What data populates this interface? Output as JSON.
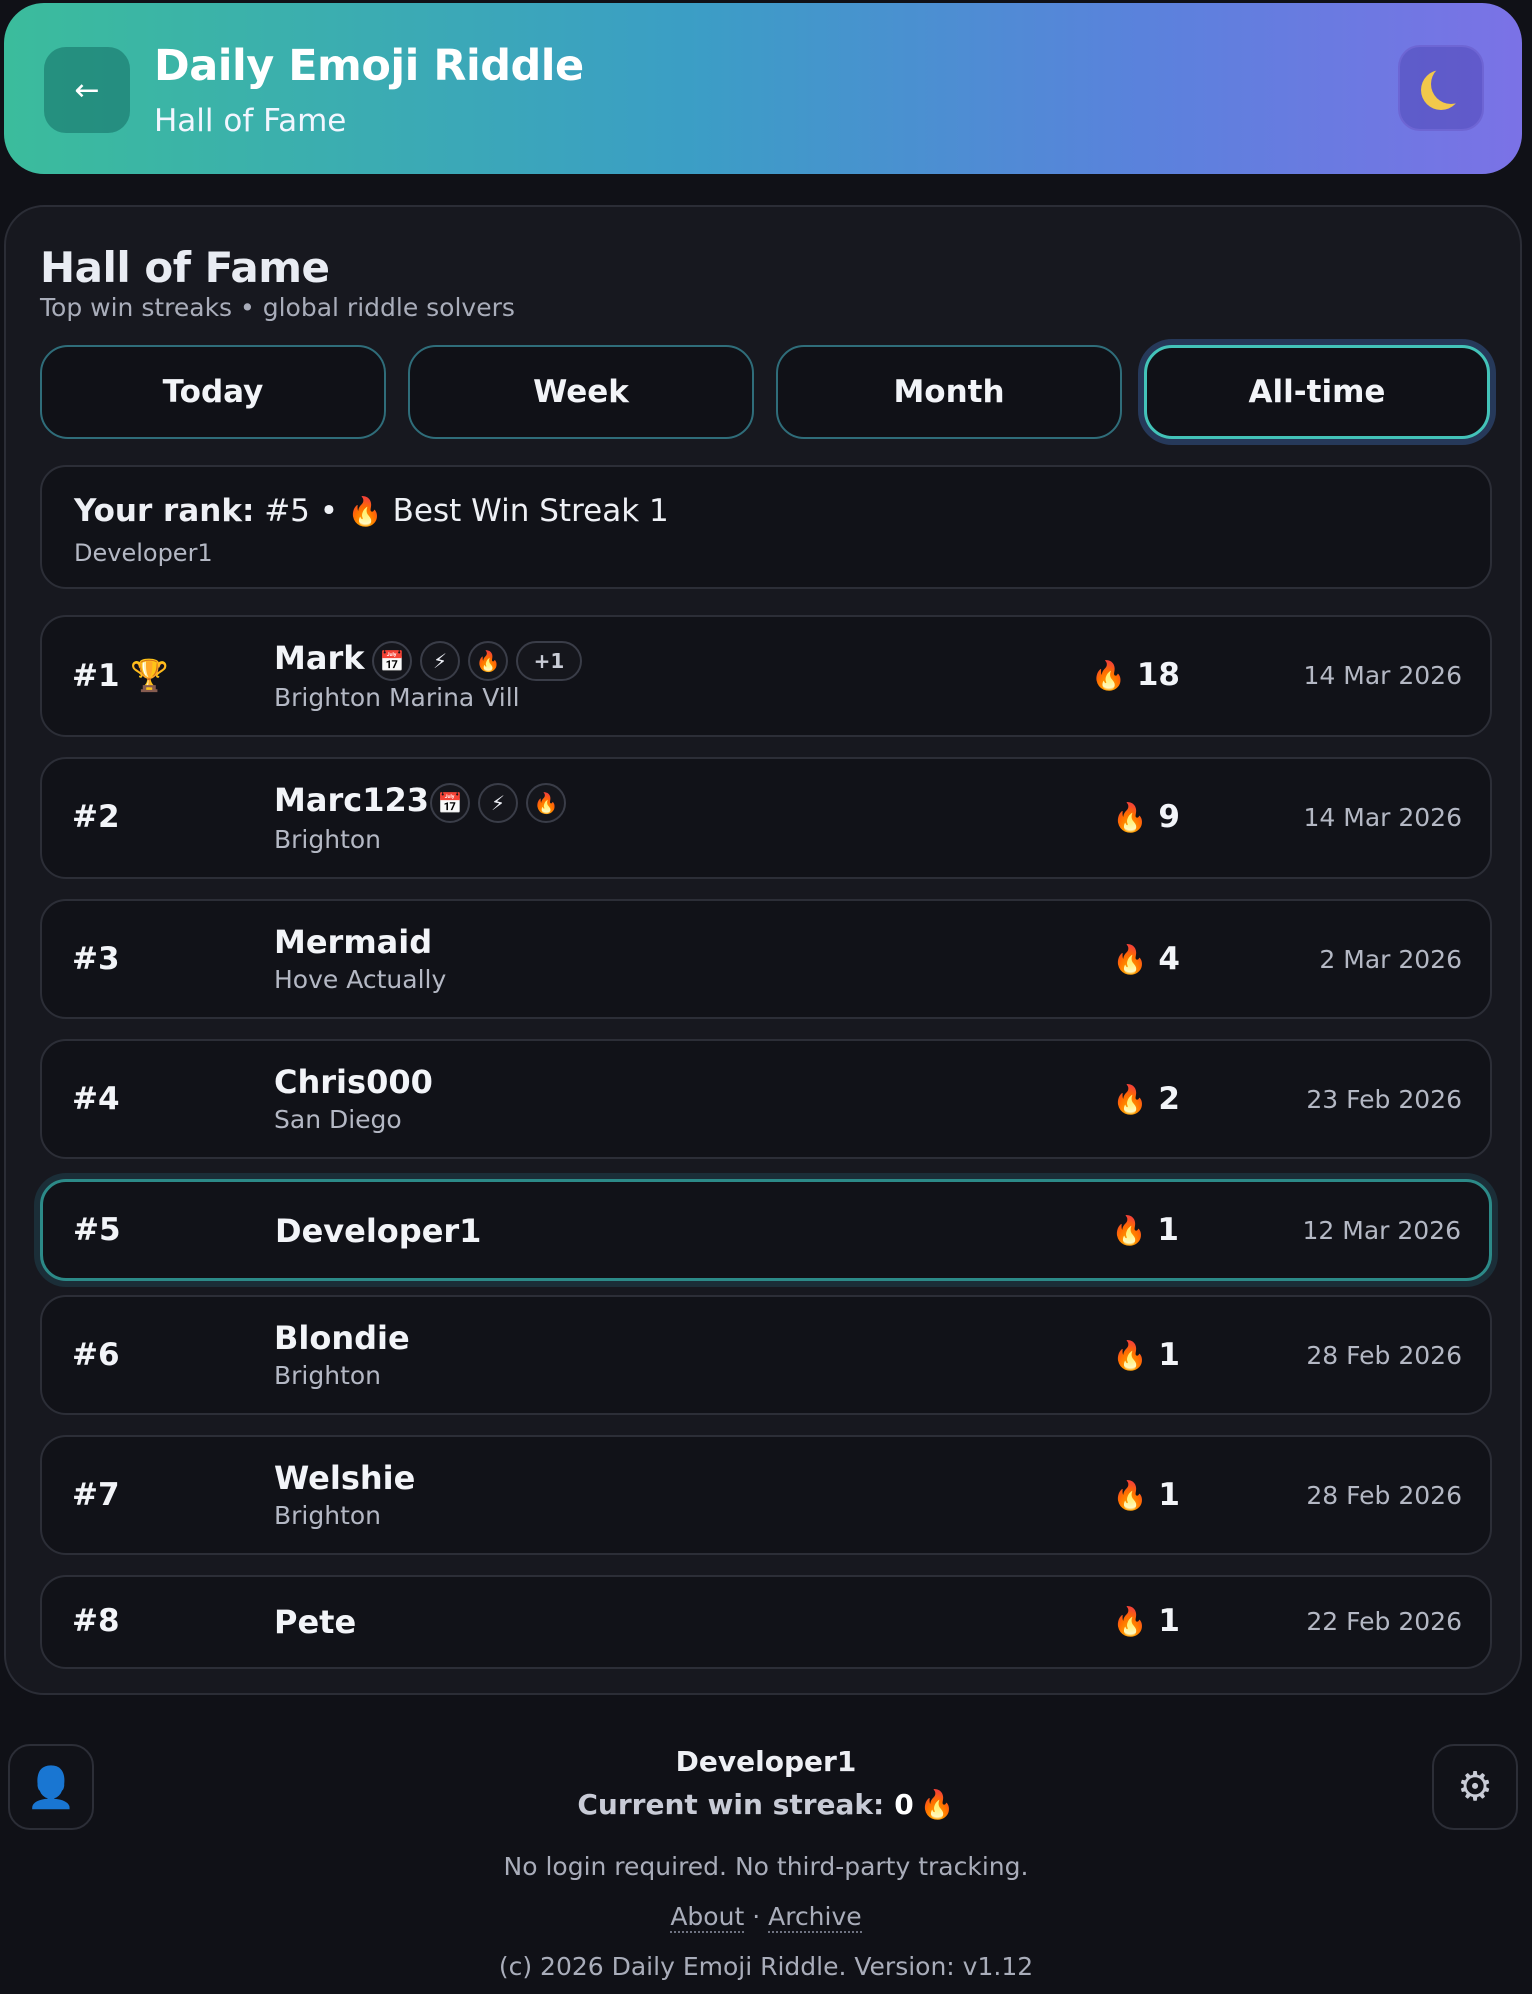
{
  "header": {
    "title": "Daily Emoji Riddle",
    "subtitle": "Hall of Fame",
    "back_icon": "←",
    "theme_icon": "moon-icon"
  },
  "section": {
    "title": "Hall of Fame",
    "subtitle": "Top win streaks • global riddle solvers"
  },
  "tabs": [
    {
      "label": "Today",
      "active": false
    },
    {
      "label": "Week",
      "active": false
    },
    {
      "label": "Month",
      "active": false
    },
    {
      "label": "All-time",
      "active": true
    }
  ],
  "your_rank": {
    "label": "Your rank:",
    "rank": "#5",
    "separator": "•",
    "streak_text": "Best Win Streak 1",
    "user": "Developer1"
  },
  "leaderboard": [
    {
      "rank": "#1",
      "trophy": "🏆",
      "name": "Mark",
      "location": "Brighton Marina Vill",
      "badges": [
        "📅",
        "⚡",
        "🔥"
      ],
      "more": "+1",
      "streak": "18",
      "date": "14 Mar 2026"
    },
    {
      "rank": "#2",
      "name": "Marc123",
      "location": "Brighton",
      "badges": [
        "📅",
        "⚡",
        "🔥"
      ],
      "streak": "9",
      "date": "14 Mar 2026"
    },
    {
      "rank": "#3",
      "name": "Mermaid",
      "location": "Hove Actually",
      "streak": "4",
      "date": "2 Mar 2026"
    },
    {
      "rank": "#4",
      "name": "Chris000",
      "location": "San Diego",
      "streak": "2",
      "date": "23 Feb 2026"
    },
    {
      "rank": "#5",
      "name": "Developer1",
      "location": "",
      "streak": "1",
      "date": "12 Mar 2026",
      "me": true
    },
    {
      "rank": "#6",
      "name": "Blondie",
      "location": "Brighton",
      "streak": "1",
      "date": "28 Feb 2026"
    },
    {
      "rank": "#7",
      "name": "Welshie",
      "location": "Brighton",
      "streak": "1",
      "date": "28 Feb 2026"
    },
    {
      "rank": "#8",
      "name": "Pete",
      "location": "",
      "streak": "1",
      "date": "22 Feb 2026"
    }
  ],
  "fire_icon": "🔥",
  "footer": {
    "user": "Developer1",
    "streak_label": "Current win streak:",
    "streak_value": "0",
    "note": "No login required. No third-party tracking.",
    "about": "About",
    "link_sep": "·",
    "archive": "Archive",
    "copyright": "(c) 2026 Daily Emoji Riddle. Version: v1.12",
    "profile_icon": "👤",
    "settings_icon": "⚙"
  },
  "colors": {
    "accent_teal": "#43c3b9",
    "header_start": "#3bbc9c",
    "header_end": "#7b72e6",
    "background": "#101117"
  }
}
